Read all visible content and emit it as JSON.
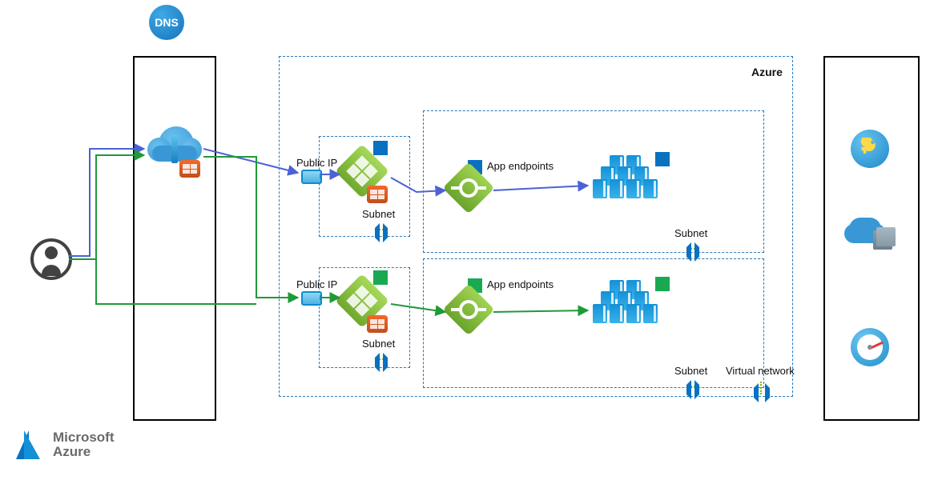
{
  "diagram": {
    "dns_badge": "DNS",
    "azure_box_title": "Azure",
    "row1": {
      "public_ip_label": "Public IP",
      "gateway_subnet_label": "Subnet",
      "app_endpoints_label": "App endpoints",
      "tier_subnet_label": "Subnet"
    },
    "row2": {
      "public_ip_label": "Public IP",
      "gateway_subnet_label": "Subnet",
      "app_endpoints_label": "App endpoints",
      "tier_subnet_label": "Subnet"
    },
    "vnet_label": "Virtual network"
  },
  "branding": {
    "line1": "Microsoft",
    "line2": "Azure"
  },
  "icons": {
    "user": "user-icon",
    "dns": "dns-icon",
    "front_door_cloud": "front-door-cloud-icon",
    "waf": "waf-icon",
    "public_ip": "public-ip-icon",
    "app_gateway": "application-gateway-icon",
    "load_balancer": "load-balancer-icon",
    "server_cluster": "server-cluster-icon",
    "subnet": "subnet-icon",
    "vnet": "virtual-network-icon",
    "key_vault": "key-vault-icon",
    "storage_cloud": "cloud-storage-icon",
    "dashboard_gauge": "gauge-icon",
    "azure_logo": "azure-logo-icon"
  },
  "colors": {
    "flow_blue": "#4b62d4",
    "flow_green": "#1f9a39",
    "azure_blue": "#0a71c1",
    "accent_green": "#1aa953"
  }
}
